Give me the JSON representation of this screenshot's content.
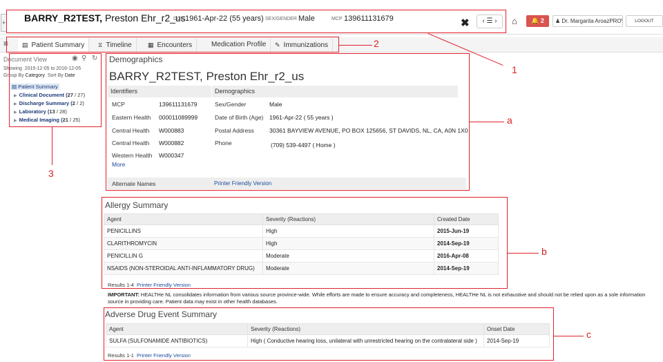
{
  "header": {
    "patient_last": "BARRY_R2TEST,",
    "patient_first": "Preston Ehr_r2_us",
    "dob_label": "DOB",
    "dob_value": "1961-Apr-22 (55 years)",
    "sex_label": "SEX/GENDER",
    "sex_value": "Male",
    "mcp_label": "MCP",
    "mcp_value": "139611131679",
    "alert_count": "2",
    "user_name": "Dr. Margarita AroazPROV",
    "logout": "LOGOUT"
  },
  "tabs": [
    {
      "label": "Patient Summary",
      "icon": "summary-icon"
    },
    {
      "label": "Timeline",
      "icon": "timeline-icon"
    },
    {
      "label": "Encounters",
      "icon": "encounters-icon"
    },
    {
      "label": "Medication Profile",
      "icon": ""
    },
    {
      "label": "Immunizations",
      "icon": "syringe-icon"
    }
  ],
  "doc_view": {
    "title": "Document View",
    "showing": "Showing",
    "date_range": "2015-12-05 to 2016-12-05",
    "group_by_label": "Group By",
    "group_by_value": "Category",
    "sort_by_label": "Sort By",
    "sort_by_value": "Date",
    "root": "Patient Summary",
    "items": [
      {
        "label": "Clinical Document",
        "count": "27",
        "total": "27"
      },
      {
        "label": "Discharge Summary",
        "count": "2",
        "total": "2"
      },
      {
        "label": "Laboratory",
        "count": "13",
        "total": "28"
      },
      {
        "label": "Medical Imaging",
        "count": "21",
        "total": "25"
      }
    ]
  },
  "demographics": {
    "title": "Demographics",
    "name": "BARRY_R2TEST, Preston Ehr_r2_us",
    "identifiers_header": "Identifiers",
    "demographics_header": "Demographics",
    "identifiers": [
      {
        "label": "MCP",
        "value": "139611131679"
      },
      {
        "label": "Eastern Health",
        "value": "000011089999"
      },
      {
        "label": "Central Health",
        "value": "W000883"
      },
      {
        "label": "Central Health",
        "value": "W000882"
      },
      {
        "label": "Western Health",
        "value": "W000347"
      }
    ],
    "fields": [
      {
        "label": "Sex/Gender",
        "value": "Male"
      },
      {
        "label": "Date of Birth (Age)",
        "value": "1961-Apr-22 ( 55 years )"
      },
      {
        "label": "Postal Address",
        "value": "30361 BAYVIEW AVENUE, PO BOX 125656, ST DAVIDS, NL, CA, A0N 1X0"
      },
      {
        "label": "Phone",
        "value": "(709) 539-4497   ( Home )"
      }
    ],
    "more": "More",
    "alternate_names": "Alternate Names",
    "printer_friendly": "Printer Friendly Version"
  },
  "allergy": {
    "title": "Allergy Summary",
    "columns": [
      "Agent",
      "Severity (Reactions)",
      "Created Date"
    ],
    "rows": [
      {
        "agent": "PENICILLINS",
        "severity": "High",
        "date": "2015-Jun-19",
        "high": true
      },
      {
        "agent": "CLARITHROMYCIN",
        "severity": "High",
        "date": "2014-Sep-19",
        "high": true
      },
      {
        "agent": "PENICILLIN G",
        "severity": "Moderate",
        "date": "2016-Apr-08",
        "high": false
      },
      {
        "agent": "NSAIDS (NON-STEROIDAL ANTI-INFLAMMATORY DRUG)",
        "severity": "Moderate",
        "date": "2014-Sep-19",
        "high": false
      }
    ],
    "results": "Results 1-4",
    "printer_friendly": "Printer Friendly Version"
  },
  "important": {
    "label": "IMPORTANT:",
    "text": "HEALTHe NL consolidates information from various source province-wide. While efforts are made to ensure accuracy and completeness, HEALTHe NL is not exhaustive and should not be relied upon as a sole information source in providing care. Patient data may exist in other health databases."
  },
  "ade": {
    "title": "Adverse Drug Event Summary",
    "columns": [
      "Agent",
      "Severity (Reactions)",
      "Onset Date"
    ],
    "rows": [
      {
        "agent": "SULFA (SULFONAMIDE ANTIBIOTICS)",
        "severity": "High ( Conductive hearing loss, unilateral with unrestricted hearing on the contralateral side )",
        "date": "2014-Sep-19"
      }
    ],
    "results": "Results 1-1",
    "printer_friendly": "Printer Friendly Version"
  },
  "annotations": [
    "1",
    "2",
    "3",
    "a",
    "b",
    "c"
  ],
  "colors": {
    "annotation": "#e0202a",
    "link": "#1a4a9a",
    "alert": "#d9534f",
    "high_severity": "#c0392b"
  }
}
